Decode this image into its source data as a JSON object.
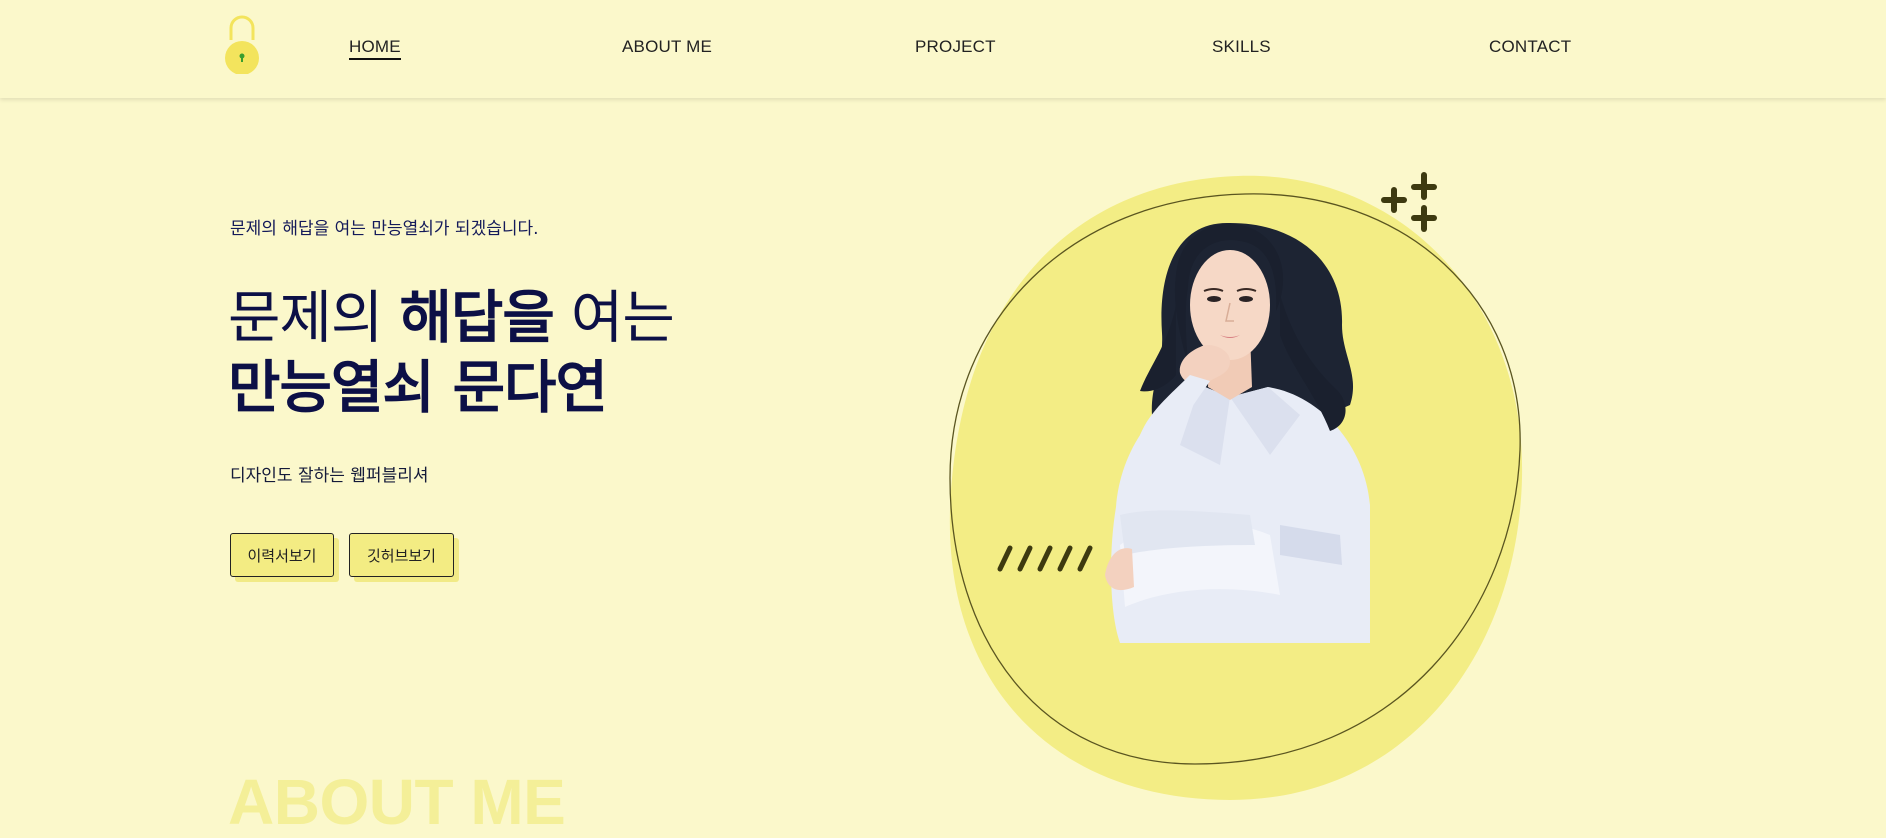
{
  "header": {
    "logo_name": "lock-icon",
    "nav": [
      {
        "label": "HOME",
        "active": true
      },
      {
        "label": "ABOUT ME",
        "active": false
      },
      {
        "label": "PROJECT",
        "active": false
      },
      {
        "label": "SKILLS",
        "active": false
      },
      {
        "label": "CONTACT",
        "active": false
      }
    ]
  },
  "hero": {
    "subtitle": "문제의 해답을 여는 만능열쇠가 되겠습니다.",
    "title_line1_a": "문제의 ",
    "title_line1_b": "해답을",
    "title_line1_c": " 여는",
    "title_line2": "만능열쇠 문다연",
    "description": "디자인도 잘하는 웹퍼블리셔",
    "buttons": {
      "resume": "이력서보기",
      "github": "깃허브보기"
    }
  },
  "section_next": {
    "title": "ABOUT ME"
  },
  "colors": {
    "background": "#fbf8cb",
    "accent_yellow": "#f3ec83",
    "navy": "#0c1046",
    "olive_dark": "#3d3a10"
  }
}
